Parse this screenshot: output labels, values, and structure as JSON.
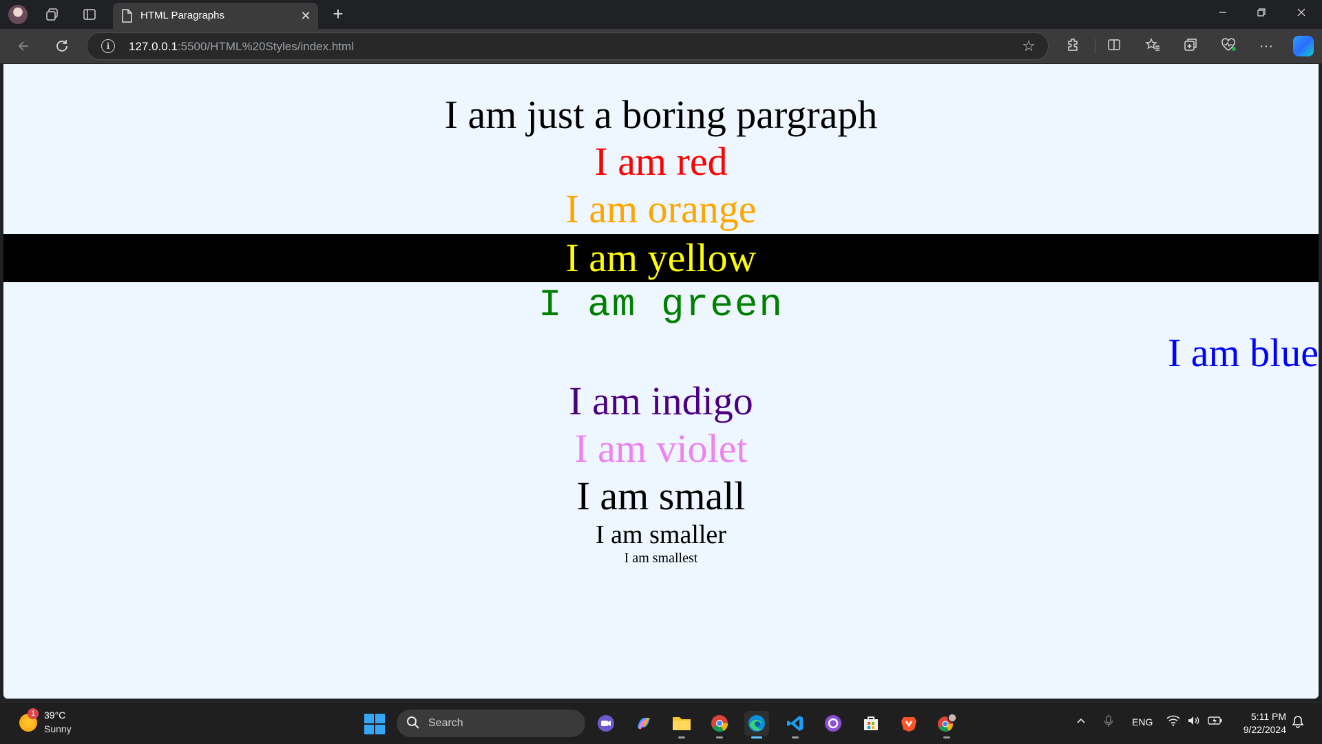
{
  "browser": {
    "tab_title": "HTML Paragraphs",
    "tab_close_glyph": "✕",
    "new_tab_glyph": "+",
    "url_host": "127.0.0.1",
    "url_rest": ":5500/HTML%20Styles/index.html"
  },
  "page": {
    "paragraphs": [
      {
        "text": "I am just a boring pargraph",
        "color": "#000000"
      },
      {
        "text": "I am red",
        "color": "#ff0000"
      },
      {
        "text": "I am orange",
        "color": "#ffa500"
      },
      {
        "text": "I am yellow",
        "color": "#ffff00",
        "background": "#000000"
      },
      {
        "text": "I am green",
        "color": "#008000"
      },
      {
        "text": "I am blue",
        "color": "#0000ff"
      },
      {
        "text": "I am indigo",
        "color": "#4b0082"
      },
      {
        "text": "I am violet",
        "color": "#ee82ee"
      },
      {
        "text": "I am small",
        "color": "#000000"
      },
      {
        "text": "I am smaller",
        "color": "#000000"
      },
      {
        "text": "I am smallest",
        "color": "#000000"
      }
    ]
  },
  "taskbar": {
    "weather_temp": "39°C",
    "weather_desc": "Sunny",
    "weather_badge": "1",
    "search_placeholder": "Search",
    "language": "ENG",
    "time": "5:11 PM",
    "date": "9/22/2024"
  }
}
